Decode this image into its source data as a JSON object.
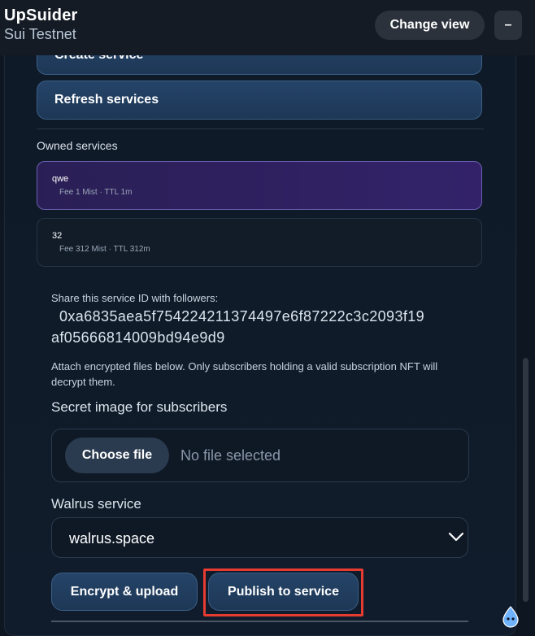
{
  "header": {
    "app_name": "UpSuider",
    "network": "Sui Testnet",
    "change_view_label": "Change view",
    "minimize_label": "–"
  },
  "actions": {
    "create_service": "Create service",
    "refresh_services": "Refresh services"
  },
  "owned_services": {
    "label": "Owned services",
    "items": [
      {
        "name": "qwe",
        "meta": "Fee 1 Mist · TTL 1m",
        "selected": true
      },
      {
        "name": "32",
        "meta": "Fee 312 Mist · TTL 312m",
        "selected": false
      }
    ]
  },
  "service_detail": {
    "share_label": "Share this service ID with followers:",
    "service_id_line1": "0xa6835aea5f754224211374497e6f87222c3c2093f19",
    "service_id_line2": "af05666814009bd94e9d9",
    "attach_note": "Attach encrypted files below. Only subscribers holding a valid subscription NFT will decrypt them."
  },
  "upload": {
    "image_label": "Secret image for subscribers",
    "choose_file": "Choose file",
    "no_file": "No file selected",
    "walrus_label": "Walrus service",
    "walrus_value": "walrus.space",
    "encrypt_upload": "Encrypt & upload",
    "publish": "Publish to service"
  },
  "colors": {
    "accent_button": "#254468",
    "selected_card": "#33226a",
    "highlight_box": "#e53b30"
  }
}
